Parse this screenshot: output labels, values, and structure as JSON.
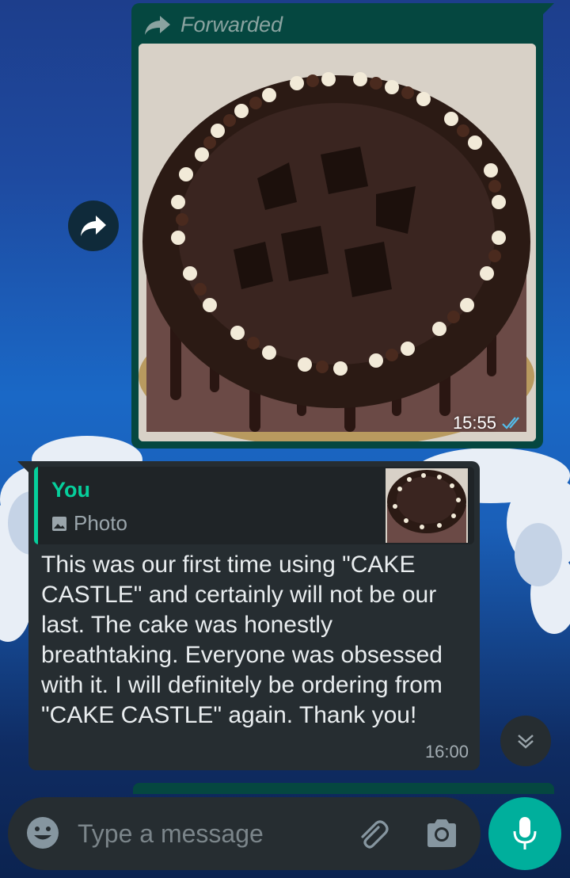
{
  "forwarded_message": {
    "label": "Forwarded",
    "time": "15:55",
    "status": "read"
  },
  "reply_message": {
    "quote_author": "You",
    "quote_type": "Photo",
    "text": "This was our first time using \"CAKE CASTLE\" and certainly will not be our last. The cake was honestly breathtaking. Everyone was obsessed with it. I will definitely be ordering from \"CAKE CASTLE\" again. Thank you!",
    "time": "16:00"
  },
  "composer": {
    "placeholder": "Type a message"
  },
  "colors": {
    "outgoing_bubble": "#054740",
    "incoming_bubble": "#262d31",
    "accent": "#06cf9c",
    "mic_button": "#00af9c",
    "read_ticks": "#53bdeb"
  }
}
